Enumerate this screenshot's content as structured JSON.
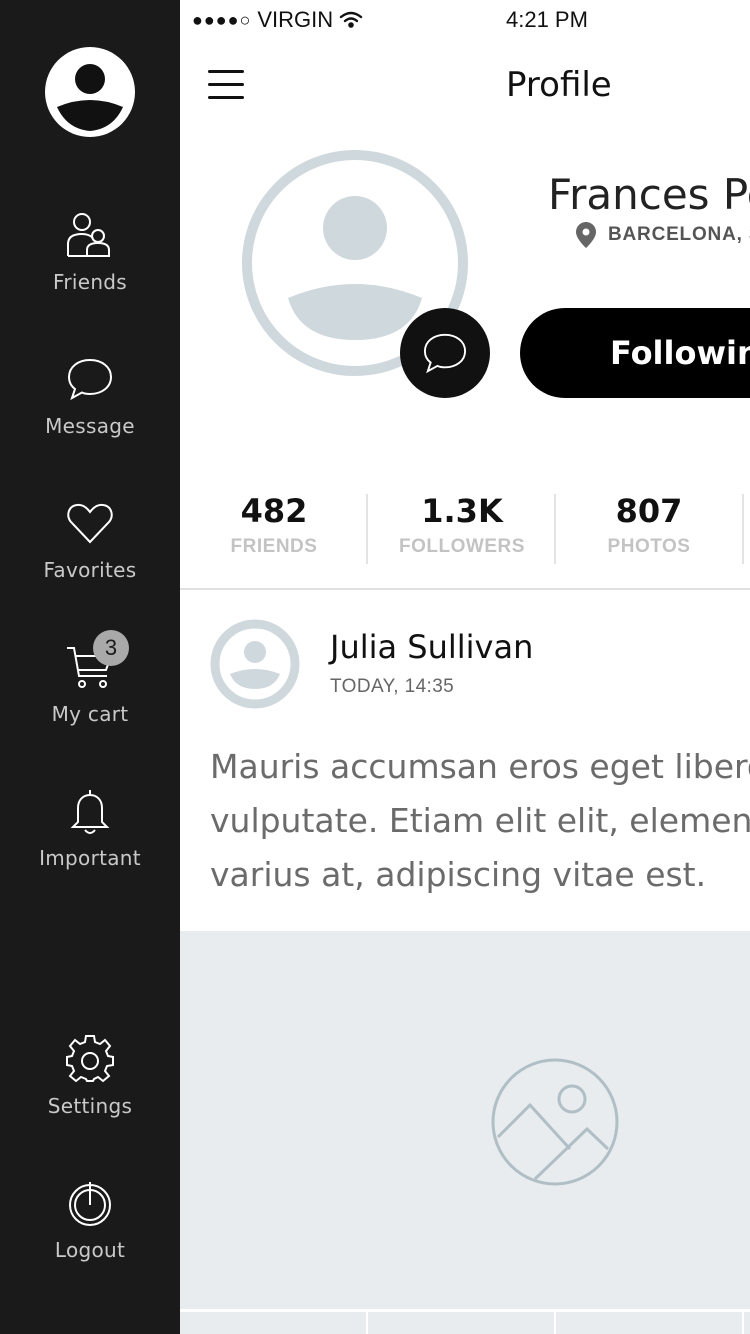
{
  "status_bar": {
    "signal": "●●●●○",
    "carrier": "VIRGIN",
    "time": "4:21 PM"
  },
  "sidebar": {
    "items": [
      {
        "label": "Friends",
        "icon": "friends-icon"
      },
      {
        "label": "Message",
        "icon": "message-icon"
      },
      {
        "label": "Favorites",
        "icon": "heart-icon"
      },
      {
        "label": "My cart",
        "icon": "cart-icon",
        "badge": "3"
      },
      {
        "label": "Important",
        "icon": "bell-icon"
      },
      {
        "label": "Settings",
        "icon": "gear-icon"
      },
      {
        "label": "Logout",
        "icon": "power-icon"
      }
    ]
  },
  "header": {
    "title": "Profile"
  },
  "profile": {
    "name": "Frances Po",
    "location": "BARCELONA, S",
    "follow_label": "Followin"
  },
  "stats": [
    {
      "value": "482",
      "label": "FRIENDS"
    },
    {
      "value": "1.3K",
      "label": "FOLLOWERS"
    },
    {
      "value": "807",
      "label": "PHOTOS"
    }
  ],
  "post": {
    "author": "Julia Sullivan",
    "time": "TODAY, 14:35",
    "lines": [
      "Mauris accumsan eros eget libero p",
      "vulputate. Etiam elit elit, elementur",
      "varius at, adipiscing vitae est."
    ]
  },
  "colors": {
    "sidebar_bg": "#1a1a1a",
    "placeholder": "#cfd8dc",
    "image_bg": "#e8ecee"
  }
}
